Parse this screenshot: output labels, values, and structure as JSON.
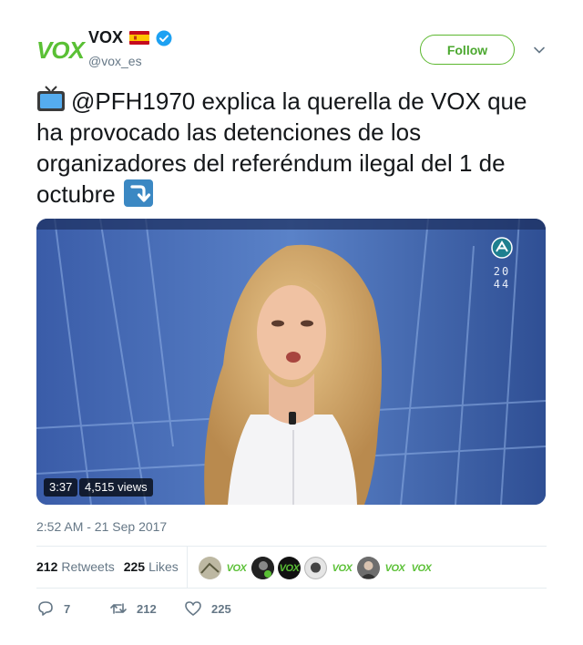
{
  "account": {
    "avatar_text": "VOX",
    "display_name": "VOX",
    "handle": "@vox_es",
    "follow_label": "Follow"
  },
  "tweet": {
    "text": "@PFH1970 explica la querella de VOX que ha provocado las detenciones de los organizadores del referéndum ilegal del 1 de octubre",
    "timestamp": "2:52 AM - 21 Sep 2017"
  },
  "video": {
    "duration": "3:37",
    "views": "4,515 views",
    "overlay_time": "20 44"
  },
  "stats": {
    "retweets_count": "212",
    "retweets_label": "Retweets",
    "likes_count": "225",
    "likes_label": "Likes"
  },
  "likers": [
    "VOX",
    "VOX",
    "VOX",
    "VOX",
    "VOX"
  ],
  "actions": {
    "reply_count": "7",
    "retweet_count": "212",
    "like_count": "225"
  },
  "colors": {
    "brand_green": "#5ac035",
    "verified_blue": "#1da1f2",
    "muted": "#657786"
  }
}
